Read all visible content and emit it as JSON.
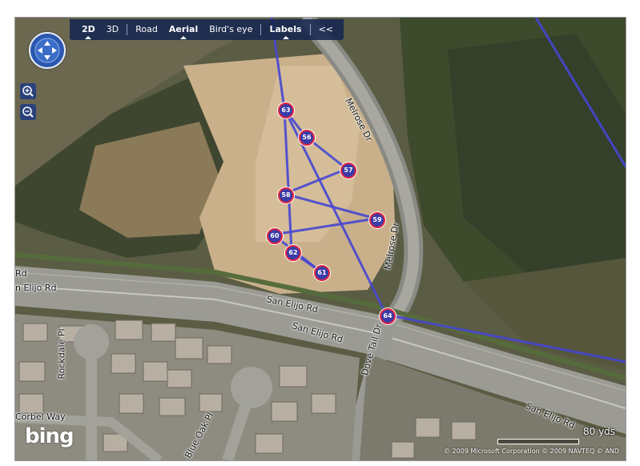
{
  "toolbar": {
    "view_2d": "2D",
    "view_3d": "3D",
    "road": "Road",
    "aerial": "Aerial",
    "birds_eye": "Bird's eye",
    "labels": "Labels",
    "collapse": "<<"
  },
  "streets": {
    "melrose_upper": "Melrose Dr",
    "melrose_lower": "Melrose Dr",
    "san_elijo_left_edge": "Rd",
    "san_elijo_left": "n Elijo Rd",
    "san_elijo_1": "San Elijo Rd",
    "san_elijo_2": "San Elijo Rd",
    "san_elijo_3": "San Elijo Rd",
    "dove_tail": "Dove Tail Dr",
    "rockdale": "Rockdale Pl",
    "corbel": "Corbel Way",
    "blue_oak": "Blue Oak Pl"
  },
  "markers": [
    {
      "id": "m56",
      "label": "56"
    },
    {
      "id": "m57",
      "label": "57"
    },
    {
      "id": "m58",
      "label": "58"
    },
    {
      "id": "m59",
      "label": "59"
    },
    {
      "id": "m60",
      "label": "60"
    },
    {
      "id": "m61",
      "label": "61"
    },
    {
      "id": "m62",
      "label": "62"
    },
    {
      "id": "m63",
      "label": "63"
    },
    {
      "id": "m64",
      "label": "64"
    }
  ],
  "logo": "bing",
  "scale": {
    "label": "80 yds"
  },
  "copyright": "© 2009 Microsoft Corporation   © 2009 NAVTEQ   © AND",
  "colors": {
    "route": "#4040c8",
    "marker_fill": "#3a3aa8",
    "marker_ring": "#e0263c",
    "toolbar_bg": "#162650"
  }
}
